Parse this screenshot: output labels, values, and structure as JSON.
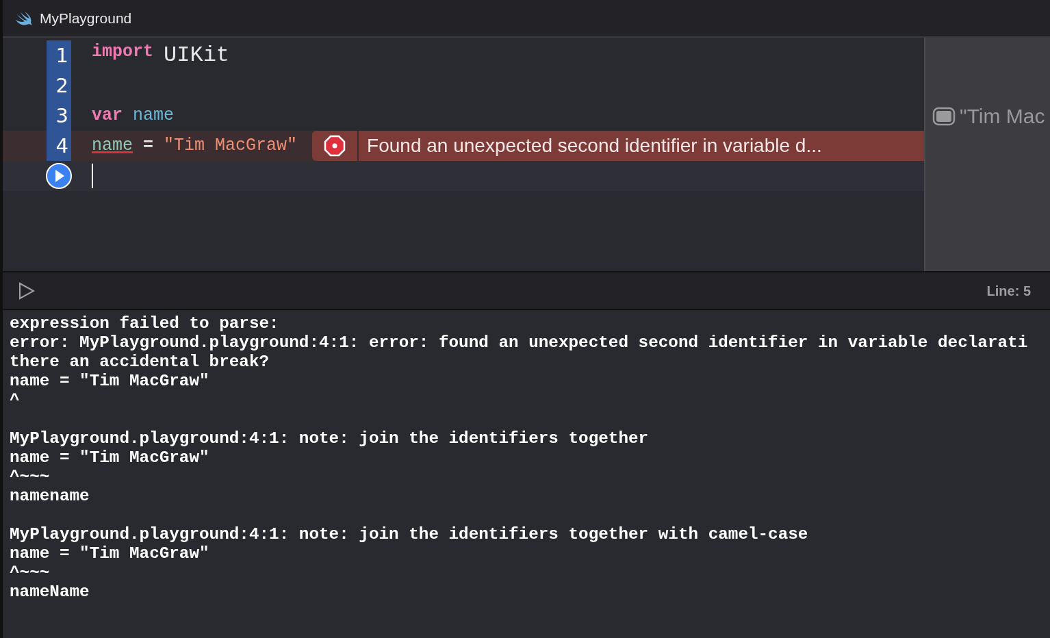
{
  "window": {
    "title": "MyPlayground"
  },
  "editor": {
    "lines": [
      {
        "number": "1",
        "error": false,
        "current": false,
        "tokens": [
          {
            "kind": "keyword",
            "text": "import"
          },
          {
            "kind": "module",
            "text": "UIKit"
          }
        ]
      },
      {
        "number": "2",
        "error": false,
        "current": false
      },
      {
        "number": "3",
        "error": false,
        "current": false,
        "tokens": [
          {
            "kind": "keyword",
            "text": "var"
          },
          {
            "kind": "declaration",
            "text": "name"
          }
        ]
      },
      {
        "number": "4",
        "error": true,
        "current": false,
        "tokens": [
          {
            "kind": "identifier",
            "text": "name"
          },
          {
            "kind": "plain",
            "text": "="
          },
          {
            "kind": "string",
            "text": "\"Tim MacGraw\""
          }
        ],
        "error_message": "Found an unexpected second identifier in variable d..."
      },
      {
        "error": false,
        "current": true
      }
    ]
  },
  "results": [
    {
      "text": "\"Tim Mac"
    }
  ],
  "debug_bar": {
    "position": "Line: 5"
  },
  "console": {
    "blocks": [
      [
        "expression failed to parse:",
        "error: MyPlayground.playground:4:1: error: found an unexpected second identifier in variable declarati",
        "there an accidental break?",
        "name = \"Tim MacGraw\"",
        "^"
      ],
      [
        "MyPlayground.playground:4:1: note: join the identifiers together",
        "name = \"Tim MacGraw\"",
        "^~~~",
        "namename"
      ],
      [
        "MyPlayground.playground:4:1: note: join the identifiers together with camel-case",
        "name = \"Tim MacGraw\"",
        "^~~~",
        "nameName"
      ]
    ]
  }
}
